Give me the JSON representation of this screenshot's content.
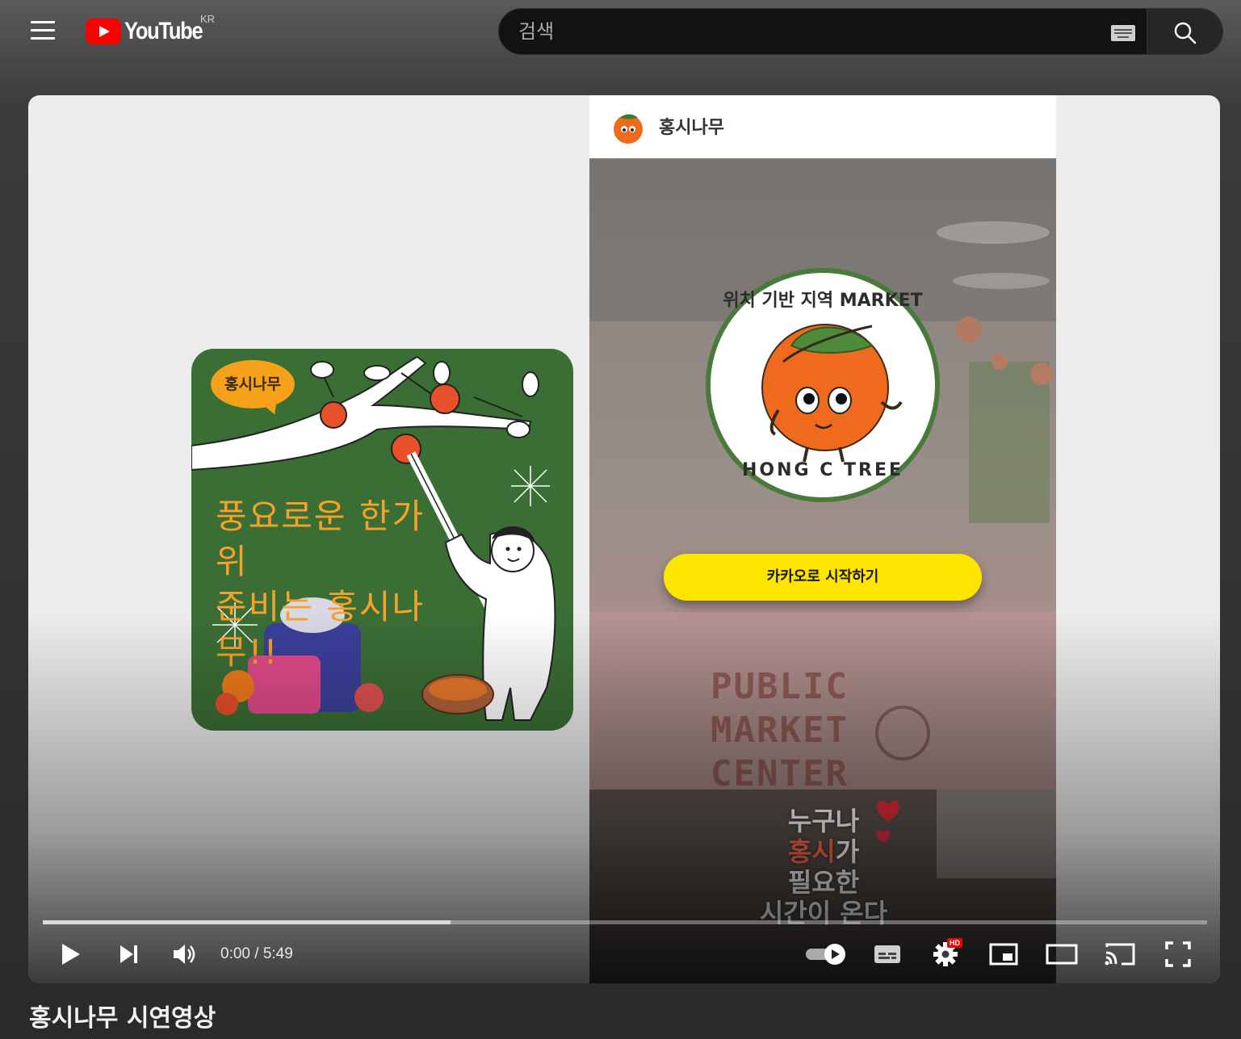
{
  "header": {
    "logo_text": "YouTube",
    "country_code": "KR",
    "search_placeholder": "검색"
  },
  "video": {
    "title": "홍시나무 시연영상",
    "current_time": "0:00",
    "duration": "5:49",
    "time_display": "0:00 / 5:49",
    "loaded_fraction": 0.35,
    "played_fraction": 0.0,
    "autoplay_on": true,
    "quality_badge": "HD"
  },
  "card": {
    "bubble_text": "홍시나무",
    "message_line1": "풍요로운 한가위",
    "message_line2": "준비는 홍시나무!!"
  },
  "phone": {
    "brand": "홍시나무",
    "badge_top": "위치 기반 지역 MARKET",
    "badge_bottom": "HONG C TREE",
    "kakao_button": "카카오로 시작하기",
    "market_sign_line1": "PUBLIC",
    "market_sign_line2": "MARKET",
    "market_sign_line3": "CENTER",
    "slogan_line1": "누구나",
    "slogan_line2_accent": "홍시",
    "slogan_line2_rest": "가",
    "slogan_line3": "필요한",
    "slogan_line4": "시간이 온다"
  },
  "colors": {
    "brand_red": "#ff0000",
    "card_green": "#3b6e35",
    "card_orange": "#f6a12a",
    "kakao_yellow": "#fee500",
    "persimmon": "#f06a1e"
  },
  "icons": [
    "menu-icon",
    "youtube-logo-icon",
    "keyboard-icon",
    "search-icon",
    "play-icon",
    "next-icon",
    "volume-icon",
    "autoplay-toggle-icon",
    "subtitles-icon",
    "settings-icon",
    "miniplayer-icon",
    "theater-mode-icon",
    "cast-icon",
    "fullscreen-icon"
  ]
}
